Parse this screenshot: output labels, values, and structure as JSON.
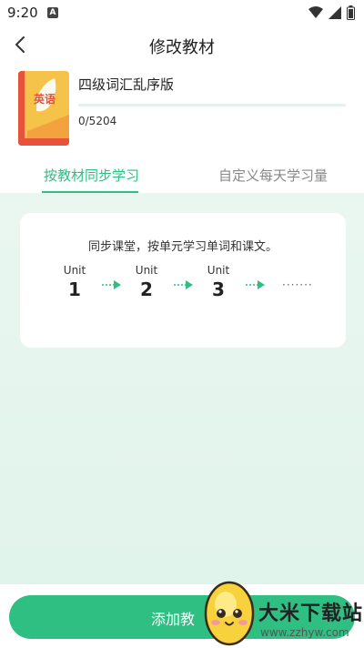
{
  "status": {
    "time": "9:20",
    "notification_badge": "A"
  },
  "nav": {
    "title": "修改教材"
  },
  "book": {
    "title": "四级词汇乱序版",
    "cover_label": "英语",
    "progress_text": "0/5204",
    "progress_fraction": 0
  },
  "tabs": [
    {
      "label": "按教材同步学习"
    },
    {
      "label": "自定义每天学习量"
    }
  ],
  "info": {
    "description": "同步课堂，按单元学习单词和课文。",
    "units": [
      {
        "word": "Unit",
        "number": "1"
      },
      {
        "word": "Unit",
        "number": "2"
      },
      {
        "word": "Unit",
        "number": "3"
      }
    ],
    "ellipsis": "·······"
  },
  "bottom": {
    "add_button_label": "添加教"
  },
  "watermark": {
    "title": "大米下载站",
    "url": "www.zzhyw.com"
  },
  "colors": {
    "accent": "#2fbf83",
    "cover_yellow": "#f5c34a",
    "cover_red": "#e8513a"
  }
}
